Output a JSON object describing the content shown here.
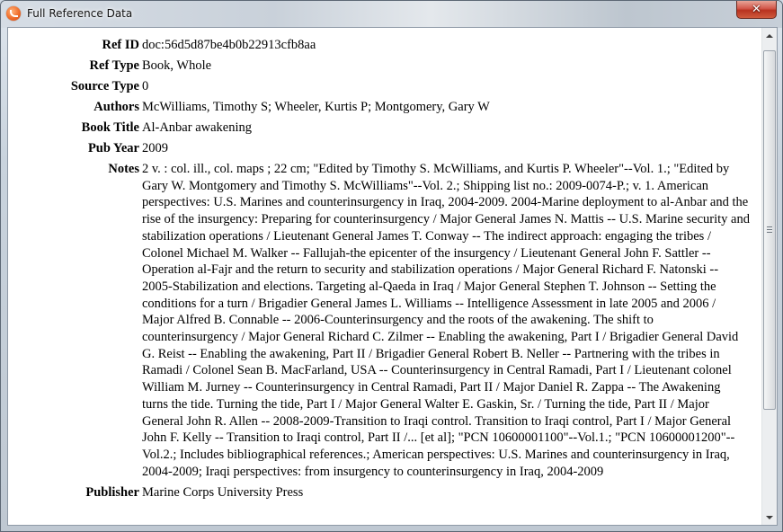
{
  "window": {
    "title": "Full Reference Data",
    "close_glyph": "✕",
    "app_icon": "app-logo-icon"
  },
  "fields": [
    {
      "label": "Ref ID",
      "value": "doc:56d5d87be4b0b22913cfb8aa"
    },
    {
      "label": "Ref Type",
      "value": "Book, Whole"
    },
    {
      "label": "Source Type",
      "value": "0"
    },
    {
      "label": "Authors",
      "value": "McWilliams, Timothy S; Wheeler, Kurtis P; Montgomery, Gary W"
    },
    {
      "label": "Book Title",
      "value": "Al-Anbar awakening"
    },
    {
      "label": "Pub Year",
      "value": "2009"
    },
    {
      "label": "Notes",
      "value": "2 v. : col. ill., col. maps ; 22 cm; \"Edited by Timothy S. McWilliams, and Kurtis P. Wheeler\"--Vol. 1.; \"Edited by Gary W. Montgomery and Timothy S. McWilliams\"--Vol. 2.; Shipping list no.: 2009-0074-P.; v. 1. American perspectives: U.S. Marines and counterinsurgency in Iraq, 2004-2009. 2004-Marine deployment to al-Anbar and the rise of the insurgency: Preparing for counterinsurgency / Major General James N. Mattis -- U.S. Marine security and stabilization operations / Lieutenant General James T. Conway -- The indirect approach: engaging the tribes / Colonel Michael M. Walker -- Fallujah-the epicenter of the insurgency / Lieutenant General John F. Sattler -- Operation al-Fajr and the return to security and stabilization operations / Major General Richard F. Natonski -- 2005-Stabilization and elections. Targeting al-Qaeda in Iraq / Major General Stephen T. Johnson -- Setting the conditions for a turn / Brigadier General James L. Williams -- Intelligence Assessment in late 2005 and 2006 / Major Alfred B. Connable -- 2006-Counterinsurgency and the roots of the awakening. The shift to counterinsurgency / Major General Richard C. Zilmer -- Enabling the awakening, Part I / Brigadier General David G. Reist -- Enabling the awakening, Part II / Brigadier General Robert B. Neller -- Partnering with the tribes in Ramadi / Colonel Sean B. MacFarland, USA -- Counterinsurgency in Central Ramadi, Part I / Lieutenant colonel William M. Jurney -- Counterinsurgency in Central Ramadi, Part II / Major Daniel R. Zappa -- The Awakening turns the tide. Turning the tide, Part I / Major General Walter E. Gaskin, Sr. / Turning the tide, Part II / Major General John R. Allen -- 2008-2009-Transition to Iraqi control. Transition to Iraqi control, Part I / Major General John F. Kelly -- Transition to Iraqi control, Part II /... [et al]; \"PCN 10600001100\"--Vol.1.; \"PCN 10600001200\"--Vol.2.; Includes bibliographical references.; American perspectives: U.S. Marines and counterinsurgency in Iraq, 2004-2009; Iraqi perspectives: from insurgency to counterinsurgency in Iraq, 2004-2009"
    },
    {
      "label": "Publisher",
      "value": "Marine Corps University Press"
    }
  ],
  "scrollbar": {
    "up_icon": "scroll-up-arrow-icon",
    "down_icon": "scroll-down-arrow-icon",
    "position_fraction": 0.0
  }
}
